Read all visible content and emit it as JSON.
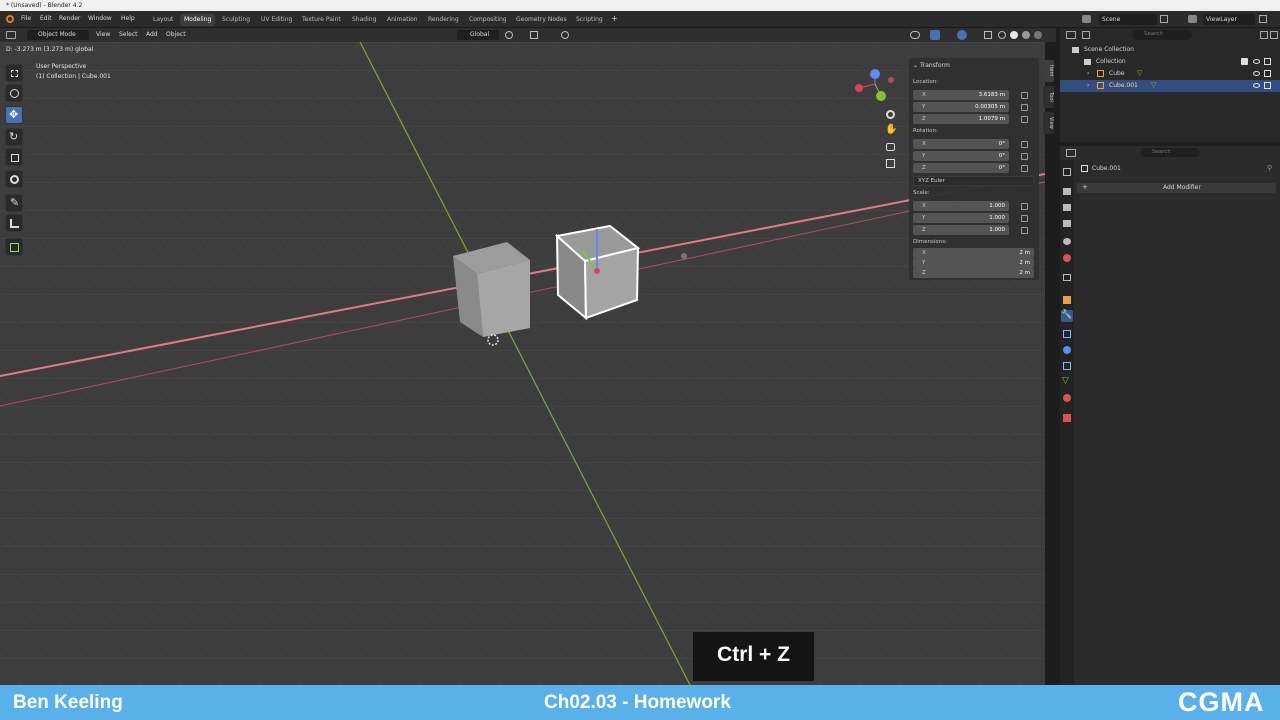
{
  "window": {
    "title": "* (Unsaved) - Blender 4.2"
  },
  "menu": {
    "file": "File",
    "edit": "Edit",
    "render": "Render",
    "window": "Window",
    "help": "Help"
  },
  "workspaces": [
    "Layout",
    "Modeling",
    "Sculpting",
    "UV Editing",
    "Texture Paint",
    "Shading",
    "Animation",
    "Rendering",
    "Compositing",
    "Geometry Nodes",
    "Scripting"
  ],
  "active_workspace": "Modeling",
  "top_right": {
    "scene": "Scene",
    "view_layer": "ViewLayer"
  },
  "viewport_header": {
    "mode": "Object Mode",
    "view": "View",
    "select": "Select",
    "add": "Add",
    "object": "Object",
    "orientation": "Global"
  },
  "status_line": "D: -3.273 m (3.273 m) global",
  "viewport": {
    "perspective": "User Perspective",
    "collection_info": "(1) Collection | Cube.001"
  },
  "npanel": {
    "tabs": [
      "Item",
      "Tool",
      "View"
    ],
    "section": "Transform",
    "location_label": "Location:",
    "location": [
      {
        "axis": "X",
        "value": "3.6183 m"
      },
      {
        "axis": "Y",
        "value": "0.00305 m"
      },
      {
        "axis": "Z",
        "value": "1.0079 m"
      }
    ],
    "rotation_label": "Rotation:",
    "rotation": [
      {
        "axis": "X",
        "value": "0°"
      },
      {
        "axis": "Y",
        "value": "0°"
      },
      {
        "axis": "Z",
        "value": "0°"
      }
    ],
    "rotation_mode": "XYZ Euler",
    "scale_label": "Scale:",
    "scale": [
      {
        "axis": "X",
        "value": "1.000"
      },
      {
        "axis": "Y",
        "value": "1.000"
      },
      {
        "axis": "Z",
        "value": "1.000"
      }
    ],
    "dimensions_label": "Dimensions:",
    "dimensions": [
      {
        "axis": "X",
        "value": "2 m"
      },
      {
        "axis": "Y",
        "value": "2 m"
      },
      {
        "axis": "Z",
        "value": "2 m"
      }
    ]
  },
  "outliner": {
    "search_placeholder": "Search",
    "scene_collection": "Scene Collection",
    "collection": "Collection",
    "items": [
      "Cube",
      "Cube.001"
    ]
  },
  "properties": {
    "search_placeholder": "Search",
    "object_name": "Cube.001",
    "add_modifier": "Add Modifier"
  },
  "overlay": {
    "shortcut": "Ctrl + Z"
  },
  "footer": {
    "author": "Ben Keeling",
    "lesson": "Ch02.03 - Homework",
    "logo": "CGMA"
  },
  "colors": {
    "accent": "#4772b3",
    "footer": "#5ab0e8",
    "x_axis": "#e06b7e",
    "y_axis": "#8cb536",
    "selection": "#ffffff"
  }
}
